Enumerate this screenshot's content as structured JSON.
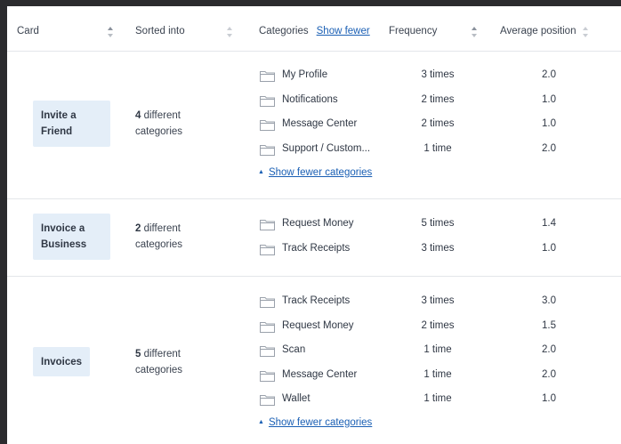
{
  "header": {
    "card": "Card",
    "sorted_into": "Sorted into",
    "categories": "Categories",
    "show_fewer": "Show fewer",
    "frequency": "Frequency",
    "average_position": "Average position"
  },
  "groups": [
    {
      "card": "Invite a Friend",
      "count": "4",
      "count_suffix": "different categories",
      "rows": [
        {
          "category": "My Profile",
          "frequency": "3 times",
          "avg": "2.0"
        },
        {
          "category": "Notifications",
          "frequency": "2 times",
          "avg": "1.0"
        },
        {
          "category": "Message Center",
          "frequency": "2 times",
          "avg": "1.0"
        },
        {
          "category": "Support / Custom...",
          "frequency": "1 time",
          "avg": "2.0"
        }
      ],
      "toggle": "Show fewer categories"
    },
    {
      "card": "Invoice a Business",
      "count": "2",
      "count_suffix": "different categories",
      "rows": [
        {
          "category": "Request Money",
          "frequency": "5 times",
          "avg": "1.4"
        },
        {
          "category": "Track Receipts",
          "frequency": "3 times",
          "avg": "1.0"
        }
      ],
      "toggle": ""
    },
    {
      "card": "Invoices",
      "count": "5",
      "count_suffix": "different categories",
      "rows": [
        {
          "category": "Track Receipts",
          "frequency": "3 times",
          "avg": "3.0"
        },
        {
          "category": "Request Money",
          "frequency": "2 times",
          "avg": "1.5"
        },
        {
          "category": "Scan",
          "frequency": "1 time",
          "avg": "2.0"
        },
        {
          "category": "Message Center",
          "frequency": "1 time",
          "avg": "2.0"
        },
        {
          "category": "Wallet",
          "frequency": "1 time",
          "avg": "1.0"
        }
      ],
      "toggle": "Show fewer categories"
    }
  ],
  "colors": {
    "chip_bg": "#e4eef8",
    "link": "#1a5fb4",
    "divider": "#e3e6ea"
  }
}
